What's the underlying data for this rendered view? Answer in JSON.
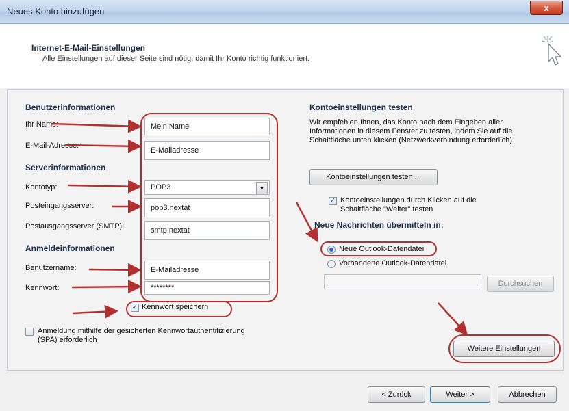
{
  "window": {
    "title": "Neues Konto hinzufügen",
    "close_glyph": "x"
  },
  "header": {
    "title": "Internet-E-Mail-Einstellungen",
    "subtitle": "Alle Einstellungen auf dieser Seite sind nötig, damit Ihr Konto richtig funktioniert.",
    "icon": "cursor-sparkle-icon"
  },
  "left": {
    "section_user": "Benutzerinformationen",
    "name_label": "Ihr Name:",
    "name_value": "Mein Name",
    "email_label": "E-Mail-Adresse:",
    "email_value": "E-Mailadresse",
    "section_server": "Serverinformationen",
    "type_label": "Kontotyp:",
    "type_value": "POP3",
    "incoming_label": "Posteingangsserver:",
    "incoming_value": "pop3.nextat",
    "outgoing_label": "Postausgangsserver (SMTP):",
    "outgoing_value": "smtp.nextat",
    "section_login": "Anmeldeinformationen",
    "user_label": "Benutzername:",
    "user_value": "E-Mailadresse",
    "password_label": "Kennwort:",
    "password_value": "********",
    "save_password_label": "Kennwort speichern",
    "save_password_checked": true,
    "spa_label_1": "Anmeldung mithilfe der gesicherten Kennwortauthentifizierung",
    "spa_label_2": "(SPA) erforderlich",
    "spa_checked": false
  },
  "right": {
    "section_test": "Kontoeinstellungen testen",
    "test_desc_1": "Wir empfehlen Ihnen, das Konto nach dem Eingeben aller",
    "test_desc_2": "Informationen in diesem Fenster zu testen, indem Sie auf die",
    "test_desc_3": "Schaltfläche unten klicken (Netzwerkverbindung erforderlich).",
    "test_button": "Kontoeinstellungen testen ...",
    "auto_test_label_1": "Kontoeinstellungen durch Klicken auf die",
    "auto_test_label_2": "Schaltfläche \"Weiter\" testen",
    "auto_test_checked": true,
    "section_deliver": "Neue Nachrichten übermitteln in:",
    "radio_new": "Neue Outlook-Datendatei",
    "radio_existing": "Vorhandene Outlook-Datendatei",
    "browse_button": "Durchsuchen",
    "more_settings_button": "Weitere Einstellungen"
  },
  "footer": {
    "back": "< Zurück",
    "next": "Weiter >",
    "cancel": "Abbrechen"
  },
  "annotation_color": "#b23030"
}
